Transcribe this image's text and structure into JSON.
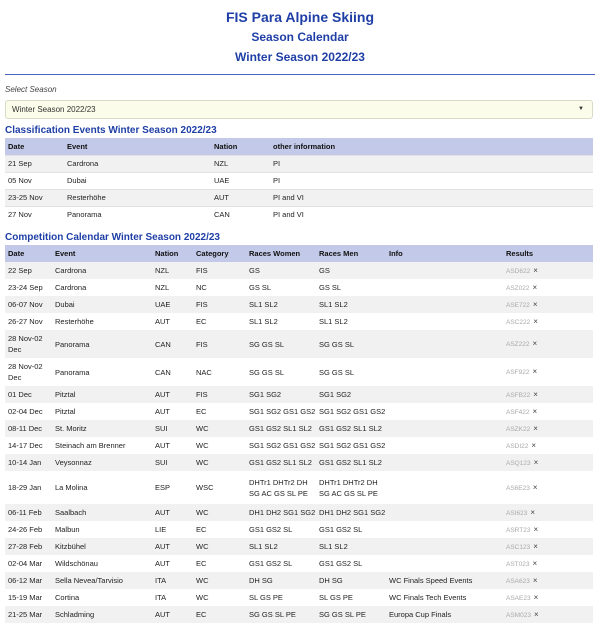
{
  "header": {
    "title": "FIS Para Alpine Skiing",
    "subtitle": "Season Calendar",
    "season": "Winter Season 2022/23"
  },
  "season_select": {
    "label": "Select Season",
    "value": "Winter Season 2022/23"
  },
  "classification": {
    "title": "Classification Events Winter Season 2022/23",
    "columns": [
      "Date",
      "Event",
      "Nation",
      "other information"
    ],
    "rows": [
      [
        "21 Sep",
        "Cardrona",
        "NZL",
        "PI"
      ],
      [
        "05 Nov",
        "Dubai",
        "UAE",
        "PI"
      ],
      [
        "23-25 Nov",
        "Resterhöhe",
        "AUT",
        "PI and VI"
      ],
      [
        "27 Nov",
        "Panorama",
        "CAN",
        "PI and VI"
      ]
    ]
  },
  "competition": {
    "title": "Competition Calendar Winter Season 2022/23",
    "columns": [
      "Date",
      "Event",
      "Nation",
      "Category",
      "Races Women",
      "Races Men",
      "Info",
      "Results"
    ],
    "result_mark": "×",
    "rows": [
      [
        "22 Sep",
        "Cardrona",
        "NZL",
        "FIS",
        "GS",
        "GS",
        "",
        "ASD622"
      ],
      [
        "23-24 Sep",
        "Cardrona",
        "NZL",
        "NC",
        "GS SL",
        "GS SL",
        "",
        "ASZ022"
      ],
      [
        "06-07 Nov",
        "Dubai",
        "UAE",
        "FIS",
        "SL1 SL2",
        "SL1 SL2",
        "",
        "ASE722"
      ],
      [
        "26-27 Nov",
        "Resterhöhe",
        "AUT",
        "EC",
        "SL1 SL2",
        "SL1 SL2",
        "",
        "ASC222"
      ],
      [
        "28 Nov-02 Dec",
        "Panorama",
        "CAN",
        "FIS",
        "SG GS SL",
        "SG GS SL",
        "",
        "ASZ222"
      ],
      [
        "28 Nov-02 Dec",
        "Panorama",
        "CAN",
        "NAC",
        "SG GS SL",
        "SG GS SL",
        "",
        "ASF922"
      ],
      [
        "01 Dec",
        "Pitztal",
        "AUT",
        "FIS",
        "SG1 SG2",
        "SG1 SG2",
        "",
        "ASFB22"
      ],
      [
        "02-04 Dec",
        "Pitztal",
        "AUT",
        "EC",
        "SG1 SG2 GS1 GS2",
        "SG1 SG2 GS1 GS2",
        "",
        "ASF422"
      ],
      [
        "08-11 Dec",
        "St. Moritz",
        "SUI",
        "WC",
        "GS1 GS2 SL1 SL2",
        "GS1 GS2 SL1 SL2",
        "",
        "ASZK22"
      ],
      [
        "14-17 Dec",
        "Steinach am Brenner",
        "AUT",
        "WC",
        "SG1 SG2 GS1 GS2",
        "SG1 SG2 GS1 GS2",
        "",
        "ASDI22"
      ],
      [
        "10-14 Jan",
        "Veysonnaz",
        "SUI",
        "WC",
        "GS1 GS2 SL1 SL2",
        "GS1 GS2 SL1 SL2",
        "",
        "ASQ123"
      ],
      [
        "18-29 Jan",
        "La Molina",
        "ESP",
        "WSC",
        "DHTr1 DHTr2 DH SG AC GS SL PE",
        "DHTr1 DHTr2 DH SG AC GS SL PE",
        "",
        "AS6E23"
      ],
      [
        "06-11 Feb",
        "Saalbach",
        "AUT",
        "WC",
        "DH1 DH2 SG1 SG2",
        "DH1 DH2 SG1 SG2",
        "",
        "ASI623"
      ],
      [
        "24-26 Feb",
        "Malbun",
        "LIE",
        "EC",
        "GS1 GS2 SL",
        "GS1 GS2 SL",
        "",
        "ASRT23"
      ],
      [
        "27-28 Feb",
        "Kitzbühel",
        "AUT",
        "WC",
        "SL1 SL2",
        "SL1 SL2",
        "",
        "ASC123"
      ],
      [
        "02-04 Mar",
        "Wildschönau",
        "AUT",
        "EC",
        "GS1 GS2 SL",
        "GS1 GS2 SL",
        "",
        "AST023"
      ],
      [
        "06-12 Mar",
        "Sella Nevea/Tarvisio",
        "ITA",
        "WC",
        "DH SG",
        "DH SG",
        "WC Finals Speed Events",
        "ASA623"
      ],
      [
        "15-19 Mar",
        "Cortina",
        "ITA",
        "WC",
        "SL GS PE",
        "SL GS PE",
        "WC Finals Tech Events",
        "ASAE23"
      ],
      [
        "21-25 Mar",
        "Schladming",
        "AUT",
        "EC",
        "SG GS SL PE",
        "SG GS SL PE",
        "Europa Cup Finals",
        "ASM023"
      ]
    ]
  }
}
